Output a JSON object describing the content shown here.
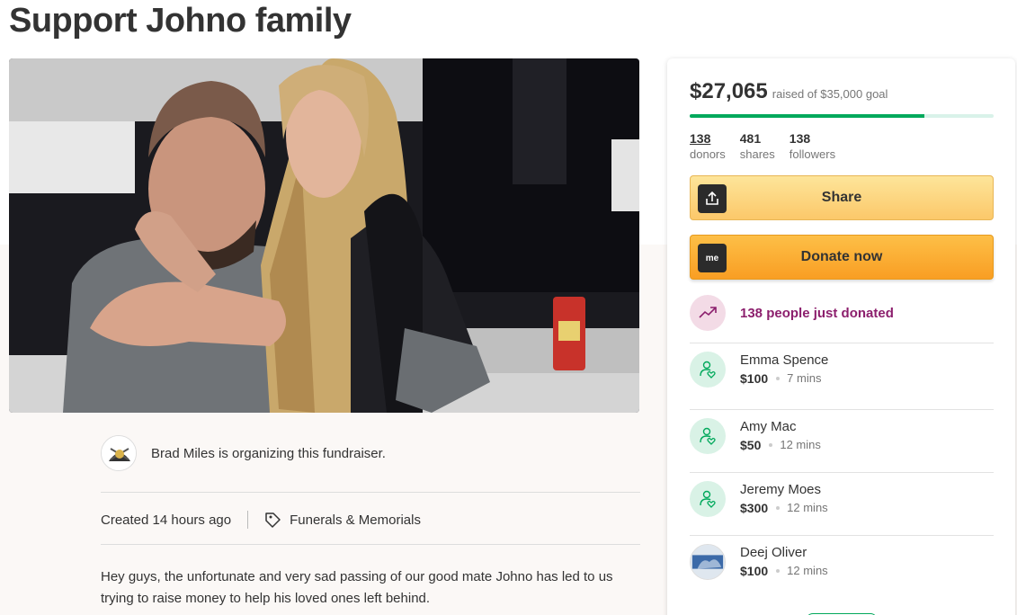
{
  "page": {
    "title": "Support Johno family",
    "accent_color": "#02a95c"
  },
  "organizer": {
    "text": "Brad Miles is organizing this fundraiser."
  },
  "meta": {
    "created": "Created 14 hours ago",
    "category": "Funerals & Memorials"
  },
  "story": {
    "text": "Hey guys, the unfortunate and very sad passing of our good mate Johno has led to us trying to raise money to help his loved ones left behind."
  },
  "sidebar": {
    "amount": "$27,065",
    "goal_text": "raised of $35,000 goal",
    "progress_fraction": 0.773,
    "stats": [
      {
        "value": "138",
        "label": "donors"
      },
      {
        "value": "481",
        "label": "shares"
      },
      {
        "value": "138",
        "label": "followers"
      }
    ],
    "share_label": "Share",
    "donate_label": "Donate now",
    "donate_icon_text": "me",
    "trend_text": "138 people just donated",
    "donations": [
      {
        "name": "Emma Spence",
        "amount": "$100",
        "time": "7 mins",
        "icon": "donor-heart-icon"
      },
      {
        "name": "Amy Mac",
        "amount": "$50",
        "time": "12 mins",
        "icon": "donor-heart-icon"
      },
      {
        "name": "Jeremy Moes",
        "amount": "$300",
        "time": "12 mins",
        "icon": "donor-heart-icon"
      },
      {
        "name": "Deej Oliver",
        "amount": "$100",
        "time": "12 mins",
        "icon": "donor-photo"
      }
    ]
  }
}
